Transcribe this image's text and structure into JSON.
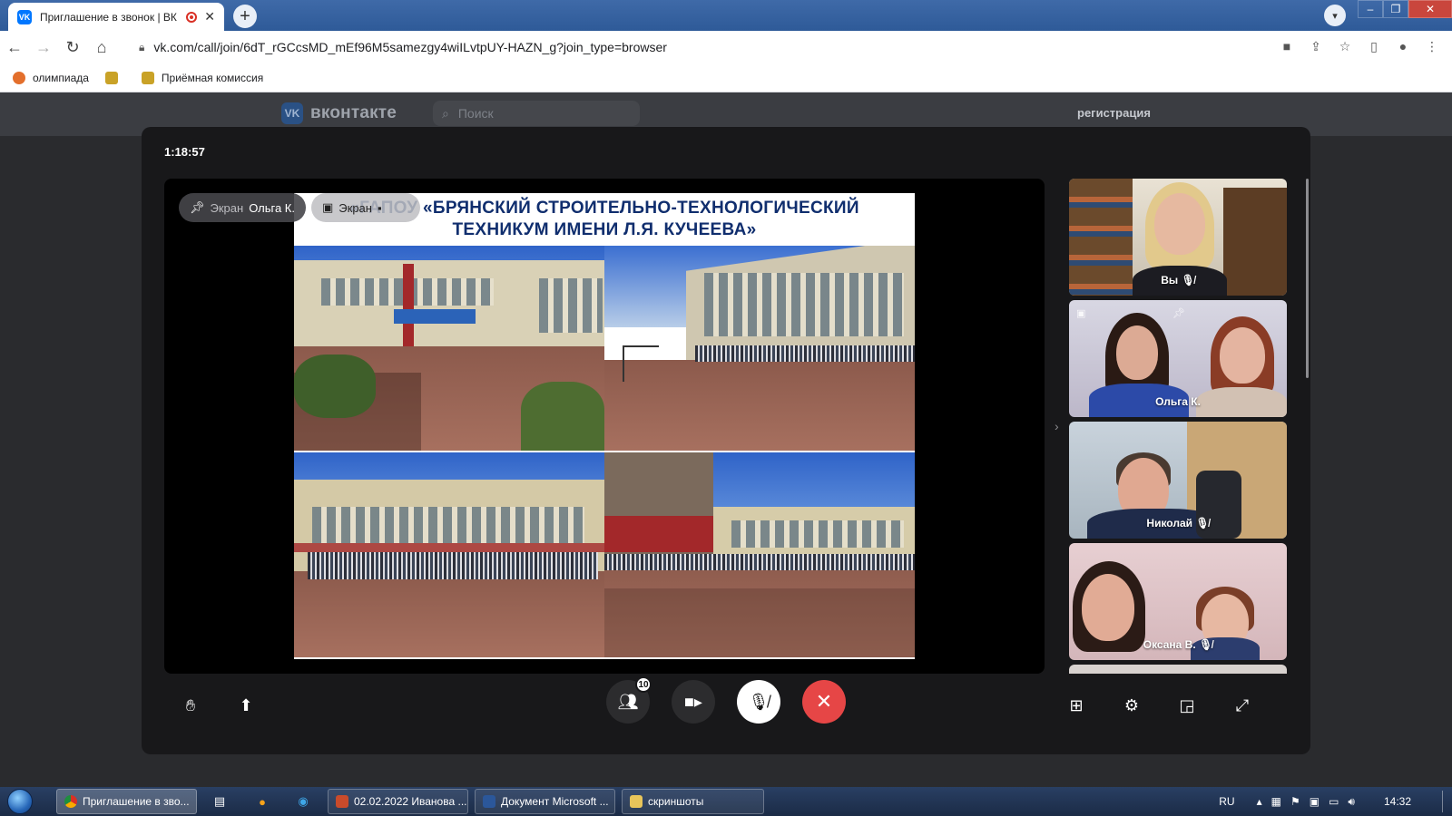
{
  "browser": {
    "tab_title": "Приглашение в звонок | ВК",
    "tab_favicon": "VK",
    "url": "vk.com/call/join/6dT_rGCcsMD_mEf96M5samezgy4wiILvtpUY-HAZN_g?join_type=browser",
    "bookmarks": [
      {
        "label": "олимпиада"
      },
      {
        "label": ""
      },
      {
        "label": "Приёмная комиссия"
      }
    ]
  },
  "vk": {
    "logo_text": "вконтакте",
    "logo_mark": "VK",
    "search_placeholder": "Поиск",
    "register": "регистрация"
  },
  "call": {
    "timer": "1:18:57",
    "screen_chip": {
      "prefix": "Экран",
      "name": "Ольга К."
    },
    "screen_chip2": "Экран",
    "slide_title_line1": "«ГАПОУ «БРЯНСКИЙ СТРОИТЕЛЬНО-ТЕХНОЛОГИЧЕСКИЙ",
    "slide_title_line2": "ТЕХНИКУМ ИМЕНИ Л.Я. КУЧЕЕВА»",
    "participants": [
      {
        "name": "Вы",
        "muted": true
      },
      {
        "name": "Ольга К.",
        "muted": false
      },
      {
        "name": "Николай",
        "muted": true
      },
      {
        "name": "Оксана В.",
        "muted": true
      }
    ],
    "participants_count": "10"
  },
  "taskbar": {
    "items": [
      {
        "label": "Приглашение в зво..."
      },
      {
        "label": "02.02.2022 Иванова ..."
      },
      {
        "label": "Документ Microsoft ..."
      },
      {
        "label": "скриншоты"
      }
    ],
    "lang": "RU",
    "time": "14:32"
  },
  "colors": {
    "vk_blue": "#0077ff",
    "end_call": "#e64646"
  }
}
